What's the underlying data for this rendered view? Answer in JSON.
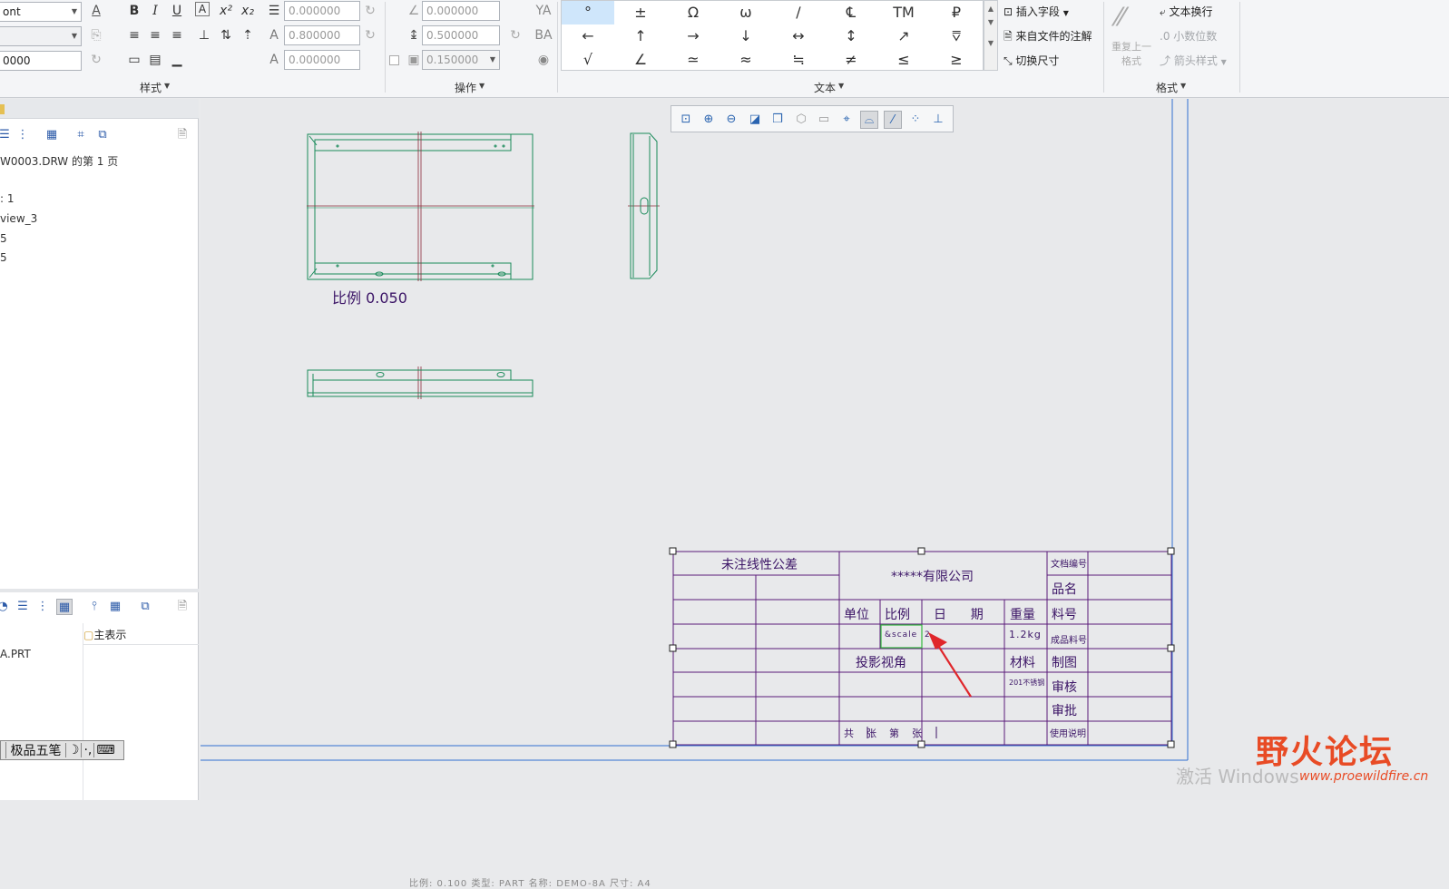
{
  "ribbon": {
    "font_field": "ont",
    "height_field": "0000",
    "style_fields": [
      "0.000000",
      "0.800000",
      "0.000000"
    ],
    "op_fields": [
      "0.000000",
      "0.500000",
      "0.150000"
    ],
    "group_style": "样式",
    "group_ops": "操作",
    "group_text": "文本",
    "group_format": "格式",
    "symbols": [
      [
        "°",
        "±",
        "Ω",
        "ω",
        "∕",
        "℄",
        "TM",
        "₽"
      ],
      [
        "←",
        "↑",
        "→",
        "↓",
        "↔",
        "↕",
        "↗",
        "⩢"
      ],
      [
        "√",
        "∠",
        "≃",
        "≈",
        "≒",
        "≠",
        "≤",
        "≥"
      ]
    ],
    "insert_field": "插入字段",
    "from_file_note": "来自文件的注解",
    "toggle_dim": "切换尺寸",
    "repeat_last_format": "重复上一格式",
    "text_wrap": "文本换行",
    "decimal_places": "小数位数",
    "arrow_style": "箭头样式"
  },
  "left_panel": {
    "tree_items": [
      "W0003.DRW 的第 1 页",
      ": 1",
      "view_3",
      "5",
      "5"
    ],
    "model_column": "主表示",
    "model_item": "A.PRT"
  },
  "drawing": {
    "scale_label": "比例 0.050"
  },
  "title_block": {
    "tolerance": "未注线性公差",
    "company": "*****有限公司",
    "doc_no": "文档编号",
    "part_name": "品名",
    "unit": "单位",
    "scale": "比例",
    "date": "日      期",
    "weight": "重量",
    "material_no": "料号",
    "scale_value": "&scale",
    "date_value": "2",
    "weight_value": "1.2kg",
    "product_no": "成品料号",
    "projection": "投影视角",
    "material": "材料",
    "drafted": "制图",
    "material_value": "201不锈钢",
    "checked": "审核",
    "approved": "审批",
    "sheets": "共    张    第    张",
    "usage": "使用说明"
  },
  "status_bar": "比例: 0.100   类型: PART   名称: DEMO-8A   尺寸: A4",
  "ime_bar": {
    "name": "极品五笔",
    "icons": [
      "☽",
      "·,",
      "⌨"
    ]
  },
  "watermarks": {
    "windows": "激活 Windows",
    "forum": "野火论坛",
    "forum_url": "www.proewildfire.cn"
  },
  "colors": {
    "model_line": "#1a8a5a",
    "center_line": "#8b2a3a",
    "table_line": "#5a1b7a",
    "text": "#3b1466",
    "highlight": "#35b83e",
    "arrow": "#e0262b",
    "border": "#2f6fd1"
  }
}
